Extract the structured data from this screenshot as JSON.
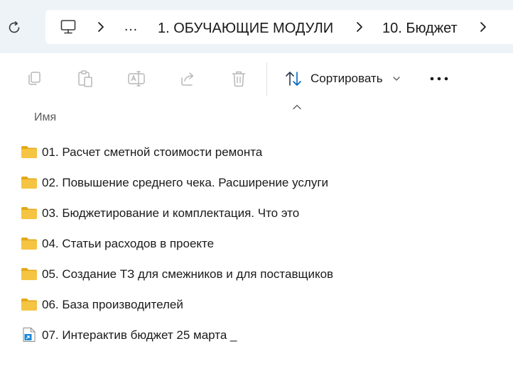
{
  "breadcrumb": {
    "items": [
      "1. ОБУЧАЮЩИЕ МОДУЛИ",
      "10. Бюджет"
    ],
    "overflow": "…"
  },
  "toolbar": {
    "sort_label": "Сортировать",
    "more_label": "•••"
  },
  "columns": {
    "name": "Имя"
  },
  "files": [
    {
      "name": "01. Расчет сметной стоимости ремонта",
      "type": "folder"
    },
    {
      "name": "02. Повышение среднего чека. Расширение услуги",
      "type": "folder"
    },
    {
      "name": "03. Бюджетирование и комплектация. Что это",
      "type": "folder"
    },
    {
      "name": "04. Статьи расходов в проекте",
      "type": "folder"
    },
    {
      "name": "05. Создание ТЗ для смежников и для поставщиков",
      "type": "folder"
    },
    {
      "name": "06. База производителей",
      "type": "folder"
    },
    {
      "name": "07. Интерактив бюджет 25 марта _",
      "type": "shortcut"
    }
  ],
  "colors": {
    "address_bg": "#eef3f8",
    "folder": "#f5c443",
    "folder_dark": "#e3a817",
    "accent": "#0067c0"
  }
}
